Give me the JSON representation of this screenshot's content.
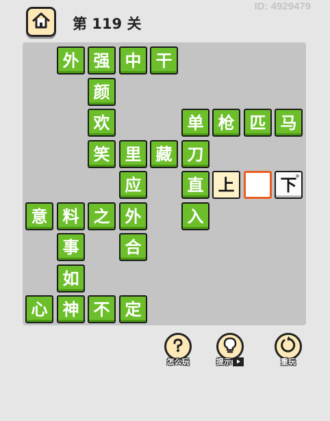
{
  "header": {
    "id_text": "ID: 4929479",
    "level_title": "第 119 关"
  },
  "tiles": [
    {
      "ch": "外",
      "state": "fixed",
      "col": 1,
      "row": 0
    },
    {
      "ch": "强",
      "state": "fixed",
      "col": 2,
      "row": 0
    },
    {
      "ch": "中",
      "state": "fixed",
      "col": 3,
      "row": 0
    },
    {
      "ch": "干",
      "state": "fixed",
      "col": 4,
      "row": 0
    },
    {
      "ch": "颜",
      "state": "fixed",
      "col": 2,
      "row": 1
    },
    {
      "ch": "欢",
      "state": "fixed",
      "col": 2,
      "row": 2
    },
    {
      "ch": "单",
      "state": "fixed",
      "col": 5,
      "row": 2
    },
    {
      "ch": "枪",
      "state": "fixed",
      "col": 6,
      "row": 2
    },
    {
      "ch": "匹",
      "state": "fixed",
      "col": 7,
      "row": 2
    },
    {
      "ch": "马",
      "state": "fixed",
      "col": 8,
      "row": 2
    },
    {
      "ch": "笑",
      "state": "fixed",
      "col": 2,
      "row": 3
    },
    {
      "ch": "里",
      "state": "fixed",
      "col": 3,
      "row": 3
    },
    {
      "ch": "藏",
      "state": "fixed",
      "col": 4,
      "row": 3
    },
    {
      "ch": "刀",
      "state": "fixed",
      "col": 5,
      "row": 3
    },
    {
      "ch": "应",
      "state": "fixed",
      "col": 3,
      "row": 4
    },
    {
      "ch": "直",
      "state": "fixed",
      "col": 5,
      "row": 4
    },
    {
      "ch": "上",
      "state": "placed",
      "col": 6,
      "row": 4
    },
    {
      "ch": "",
      "state": "selected",
      "col": 7,
      "row": 4
    },
    {
      "ch": "下",
      "state": "option",
      "col": 8,
      "row": 4
    },
    {
      "ch": "意",
      "state": "fixed",
      "col": 0,
      "row": 5
    },
    {
      "ch": "料",
      "state": "fixed",
      "col": 1,
      "row": 5
    },
    {
      "ch": "之",
      "state": "fixed",
      "col": 2,
      "row": 5
    },
    {
      "ch": "外",
      "state": "fixed",
      "col": 3,
      "row": 5
    },
    {
      "ch": "入",
      "state": "fixed",
      "col": 5,
      "row": 5
    },
    {
      "ch": "事",
      "state": "fixed",
      "col": 1,
      "row": 6
    },
    {
      "ch": "合",
      "state": "fixed",
      "col": 3,
      "row": 6
    },
    {
      "ch": "如",
      "state": "fixed",
      "col": 1,
      "row": 7
    },
    {
      "ch": "心",
      "state": "fixed",
      "col": 0,
      "row": 8
    },
    {
      "ch": "神",
      "state": "fixed",
      "col": 1,
      "row": 8
    },
    {
      "ch": "不",
      "state": "fixed",
      "col": 2,
      "row": 8
    },
    {
      "ch": "定",
      "state": "fixed",
      "col": 3,
      "row": 8
    }
  ],
  "controls": {
    "how_to_play_label": "怎么玩",
    "hint_label": "提示",
    "replay_label": "重玩"
  },
  "icons": {
    "home": "home-icon",
    "how_to_play": "question-icon",
    "hint": "lightbulb-icon",
    "replay": "replay-icon",
    "video": "video-icon"
  },
  "colors": {
    "tile_fixed": "#6cbf2b",
    "tile_placed": "#fdf1c8",
    "selected_border": "#ea5b1f",
    "board": "#c4c4c4"
  }
}
